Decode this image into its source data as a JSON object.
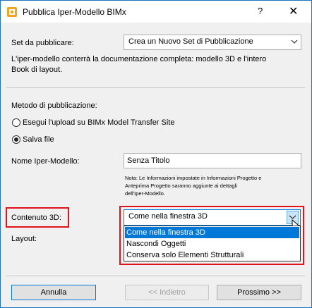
{
  "window": {
    "title": "Pubblica Iper-Modello BIMx",
    "help_glyph": "?",
    "close_glyph": "✕",
    "icon": "bimx-app-icon"
  },
  "set": {
    "label": "Set da pubblicare:",
    "value": "Crea un Nuovo Set di Pubblicazione",
    "description_line1": "L'iper-modello conterrà la documentazione completa: modello 3D e l'intero",
    "description_line2": "Book di layout."
  },
  "method": {
    "label": "Metodo di pubblicazione:",
    "option_upload": "Esegui l'upload su BIMx Model Transfer Site",
    "option_save": "Salva file",
    "selected": "Salva file"
  },
  "name": {
    "label": "Nome Iper-Modello:",
    "value": "Senza Titolo",
    "note_line1": "Nota: Le Informazioni impostate in Informazioni Progetto e",
    "note_line2": "Anteprima Progetto saranno aggiunte ai dettagli",
    "note_line3": "dell'Iper-Modello."
  },
  "content3d": {
    "label": "Contenuto 3D:",
    "value": "Come nella finestra 3D",
    "options": [
      "Come nella finestra 3D",
      "Nascondi Oggetti",
      "Conserva solo Elementi Strutturali"
    ],
    "highlighted": "Come nella finestra 3D"
  },
  "layout": {
    "label": "Layout:"
  },
  "buttons": {
    "cancel": "Annulla",
    "back": "<< Indietro",
    "next": "Prossimo >>"
  },
  "colors": {
    "accent": "#0078d7",
    "highlight_box": "#e0131a",
    "window_border": "#1e73be"
  }
}
